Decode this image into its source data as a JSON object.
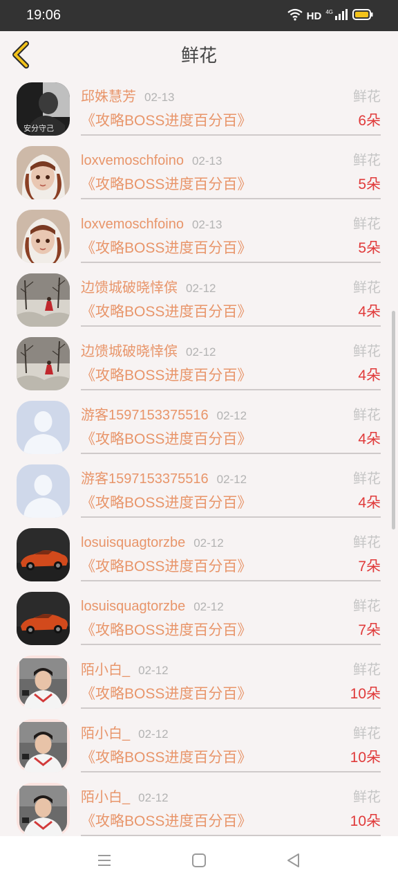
{
  "status_bar": {
    "time": "19:06",
    "hd": "HD",
    "network": "4G"
  },
  "header": {
    "title": "鲜花"
  },
  "colors": {
    "accent": "#e8956a",
    "amount": "#e03a3a",
    "muted": "#c5c5c5",
    "background": "#f7f3f3"
  },
  "rows": [
    {
      "name": "邱姝慧芳",
      "date": "02-13",
      "type": "鲜花",
      "book": "《攻略BOSS进度百分百》",
      "amount": "6朵",
      "avatar": "avatar-dark-portrait"
    },
    {
      "name": "loxvemoschfoino",
      "date": "02-13",
      "type": "鲜花",
      "book": "《攻略BOSS进度百分百》",
      "amount": "5朵",
      "avatar": "avatar-doll"
    },
    {
      "name": "loxvemoschfoino",
      "date": "02-13",
      "type": "鲜花",
      "book": "《攻略BOSS进度百分百》",
      "amount": "5朵",
      "avatar": "avatar-doll"
    },
    {
      "name": "边馈城破晓悻傧",
      "date": "02-12",
      "type": "鲜花",
      "book": "《攻略BOSS进度百分百》",
      "amount": "4朵",
      "avatar": "avatar-landscape"
    },
    {
      "name": "边馈城破晓悻傧",
      "date": "02-12",
      "type": "鲜花",
      "book": "《攻略BOSS进度百分百》",
      "amount": "4朵",
      "avatar": "avatar-landscape"
    },
    {
      "name": "游客1597153375516",
      "date": "02-12",
      "type": "鲜花",
      "book": "《攻略BOSS进度百分百》",
      "amount": "4朵",
      "avatar": "avatar-default-user"
    },
    {
      "name": "游客1597153375516",
      "date": "02-12",
      "type": "鲜花",
      "book": "《攻略BOSS进度百分百》",
      "amount": "4朵",
      "avatar": "avatar-default-user"
    },
    {
      "name": "losuisquagtorzbe",
      "date": "02-12",
      "type": "鲜花",
      "book": "《攻略BOSS进度百分百》",
      "amount": "7朵",
      "avatar": "avatar-car"
    },
    {
      "name": "losuisquagtorzbe",
      "date": "02-12",
      "type": "鲜花",
      "book": "《攻略BOSS进度百分百》",
      "amount": "7朵",
      "avatar": "avatar-car"
    },
    {
      "name": "陌小白_",
      "date": "02-12",
      "type": "鲜花",
      "book": "《攻略BOSS进度百分百》",
      "amount": "10朵",
      "avatar": "avatar-person"
    },
    {
      "name": "陌小白_",
      "date": "02-12",
      "type": "鲜花",
      "book": "《攻略BOSS进度百分百》",
      "amount": "10朵",
      "avatar": "avatar-person"
    },
    {
      "name": "陌小白_",
      "date": "02-12",
      "type": "鲜花",
      "book": "《攻略BOSS进度百分百》",
      "amount": "10朵",
      "avatar": "avatar-person"
    }
  ]
}
